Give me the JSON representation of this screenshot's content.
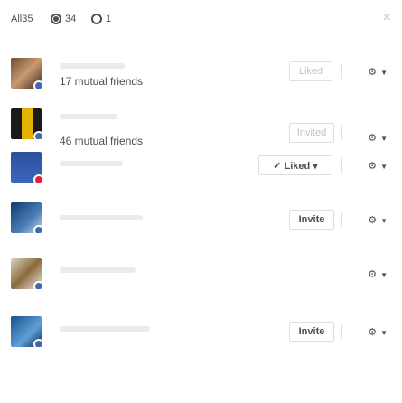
{
  "filters": {
    "all_label": "All",
    "all_count": "35",
    "liked_count": "34",
    "invited_count": "1"
  },
  "close_label": "×",
  "rows": [
    {
      "mutual": "17 mutual friends",
      "action": "Liked",
      "action_state": "disabled"
    },
    {
      "mutual": "46 mutual friends",
      "action": "Invited",
      "action_state": "disabled"
    },
    {
      "mutual": "",
      "action": "✓ Liked ▾",
      "action_state": "active"
    },
    {
      "mutual": "",
      "action": "Invite",
      "action_state": "active"
    },
    {
      "mutual": "",
      "action": "",
      "action_state": "none"
    },
    {
      "mutual": "",
      "action": "Invite",
      "action_state": "active"
    }
  ],
  "gear_icon": "gear-icon",
  "caret_icon": "caret-down-icon"
}
